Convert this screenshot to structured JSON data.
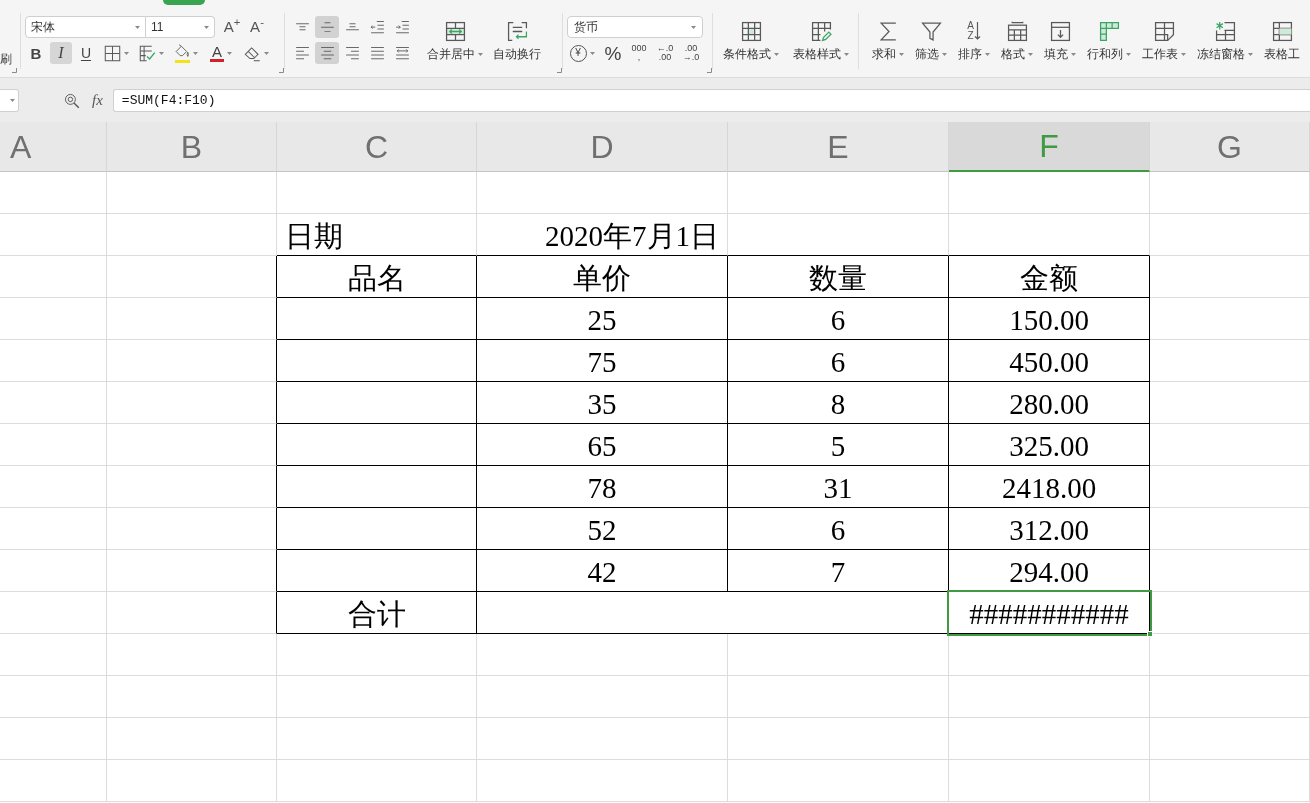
{
  "ribbon": {
    "clipboard": {
      "label": "刷"
    },
    "font": {
      "name": "宋体",
      "size": "11",
      "size_buttons": [
        {
          "glyph": "A$^{+}$"
        },
        {
          "glyph": "A$^{-}$"
        }
      ],
      "style_buttons": [
        {
          "kind": "bold",
          "glyph": "B",
          "dropdown": false,
          "pressed": false
        },
        {
          "kind": "italic",
          "glyph": "I",
          "dropdown": false,
          "pressed": true
        },
        {
          "kind": "underline",
          "glyph": "U",
          "dropdown": false,
          "pressed": false
        },
        {
          "kind": "borders",
          "dropdown": true,
          "pressed": false
        },
        {
          "kind": "cell_style",
          "dropdown": true,
          "pressed": false
        },
        {
          "kind": "fill_color",
          "color": "#f2e21c",
          "dropdown": true,
          "pressed": false
        },
        {
          "kind": "font_color",
          "glyph": "A",
          "color": "#d3202a",
          "dropdown": true,
          "pressed": false
        },
        {
          "kind": "clear",
          "dropdown": true,
          "pressed": false
        }
      ]
    },
    "alignment": {
      "vertical_buttons": [
        {
          "kind": "top",
          "pressed": false
        },
        {
          "kind": "middle",
          "pressed": true
        },
        {
          "kind": "bottom",
          "pressed": false
        },
        {
          "kind": "outdent",
          "pressed": false
        },
        {
          "kind": "indent",
          "pressed": false
        }
      ],
      "horizontal_buttons": [
        {
          "kind": "left",
          "pressed": false
        },
        {
          "kind": "center",
          "pressed": true
        },
        {
          "kind": "right",
          "pressed": false
        },
        {
          "kind": "justify",
          "pressed": false
        },
        {
          "kind": "distributed",
          "pressed": false
        }
      ],
      "big_buttons": [
        {
          "kind": "merge",
          "label": "合并居中",
          "dropdown": true
        },
        {
          "kind": "wrap",
          "label": "自动换行",
          "dropdown": false
        }
      ]
    },
    "number": {
      "format": "货币",
      "buttons": [
        {
          "kind": "currency",
          "glyph": "¥",
          "dropdown": true
        },
        {
          "kind": "percent",
          "glyph": "%",
          "dropdown": false
        },
        {
          "kind": "thousands",
          "lines": [
            "000",
            ","
          ],
          "dropdown": false
        },
        {
          "kind": "add_decimal",
          "lines": [
            "←.0",
            ".00"
          ],
          "dropdown": false
        },
        {
          "kind": "remove_decimal",
          "lines": [
            ".00",
            "→.0"
          ],
          "dropdown": false
        }
      ]
    },
    "styles": [
      {
        "kind": "conditional",
        "label": "条件格式",
        "dropdown": true
      },
      {
        "kind": "table_style",
        "label": "表格样式",
        "dropdown": true
      }
    ],
    "tools": [
      {
        "kind": "sum",
        "label": "求和",
        "dropdown": true
      },
      {
        "kind": "filter",
        "label": "筛选",
        "dropdown": true
      },
      {
        "kind": "sort",
        "label": "排序",
        "glyphs": [
          "A",
          "Z"
        ],
        "dropdown": true
      },
      {
        "kind": "format",
        "label": "格式",
        "dropdown": true
      },
      {
        "kind": "fill",
        "label": "填充",
        "dropdown": true
      },
      {
        "kind": "rows_cols",
        "label": "行和列",
        "dropdown": true
      },
      {
        "kind": "sheet",
        "label": "工作表",
        "dropdown": true
      },
      {
        "kind": "freeze",
        "label": "冻结窗格",
        "dropdown": true
      },
      {
        "kind": "table_tools",
        "label": "表格工",
        "dropdown": false
      }
    ]
  },
  "formula_bar": {
    "function_label": "fx",
    "formula": "=SUM(F4:F10)"
  },
  "sheet": {
    "columns": [
      {
        "label": "A",
        "selected": false
      },
      {
        "label": "B",
        "selected": false
      },
      {
        "label": "C",
        "selected": false
      },
      {
        "label": "D",
        "selected": false
      },
      {
        "label": "E",
        "selected": false
      },
      {
        "label": "F",
        "selected": true
      },
      {
        "label": "G",
        "selected": false
      }
    ],
    "rows": [
      {
        "kind": "blank"
      },
      {
        "kind": "info",
        "cells": [
          {
            "text": "日期",
            "selected": false
          },
          {
            "text": "2020年7月1日",
            "selected": false
          }
        ]
      },
      {
        "kind": "header",
        "cells": [
          {
            "text": "品名",
            "selected": false
          },
          {
            "text": "单价",
            "selected": false
          },
          {
            "text": "数量",
            "selected": false
          },
          {
            "text": "金额",
            "selected": false
          }
        ]
      },
      {
        "kind": "data",
        "cells": [
          {
            "text": "25",
            "selected": false
          },
          {
            "text": "6",
            "selected": false
          },
          {
            "text": "150.00",
            "selected": false
          }
        ]
      },
      {
        "kind": "data",
        "cells": [
          {
            "text": "75",
            "selected": false
          },
          {
            "text": "6",
            "selected": false
          },
          {
            "text": "450.00",
            "selected": false
          }
        ]
      },
      {
        "kind": "data",
        "cells": [
          {
            "text": "35",
            "selected": false
          },
          {
            "text": "8",
            "selected": false
          },
          {
            "text": "280.00",
            "selected": false
          }
        ]
      },
      {
        "kind": "data",
        "cells": [
          {
            "text": "65",
            "selected": false
          },
          {
            "text": "5",
            "selected": false
          },
          {
            "text": "325.00",
            "selected": false
          }
        ]
      },
      {
        "kind": "data",
        "cells": [
          {
            "text": "78",
            "selected": false
          },
          {
            "text": "31",
            "selected": false
          },
          {
            "text": "2418.00",
            "selected": false
          }
        ]
      },
      {
        "kind": "data",
        "cells": [
          {
            "text": "52",
            "selected": false
          },
          {
            "text": "6",
            "selected": false
          },
          {
            "text": "312.00",
            "selected": false
          }
        ]
      },
      {
        "kind": "data",
        "cells": [
          {
            "text": "42",
            "selected": false
          },
          {
            "text": "7",
            "selected": false
          },
          {
            "text": "294.00",
            "selected": false
          }
        ]
      },
      {
        "kind": "total",
        "cells": [
          {
            "text": "合计",
            "selected": false
          },
          {
            "text": "###########",
            "selected": true
          }
        ]
      },
      {
        "kind": "blank"
      },
      {
        "kind": "blank"
      },
      {
        "kind": "blank"
      },
      {
        "kind": "blank"
      }
    ]
  }
}
